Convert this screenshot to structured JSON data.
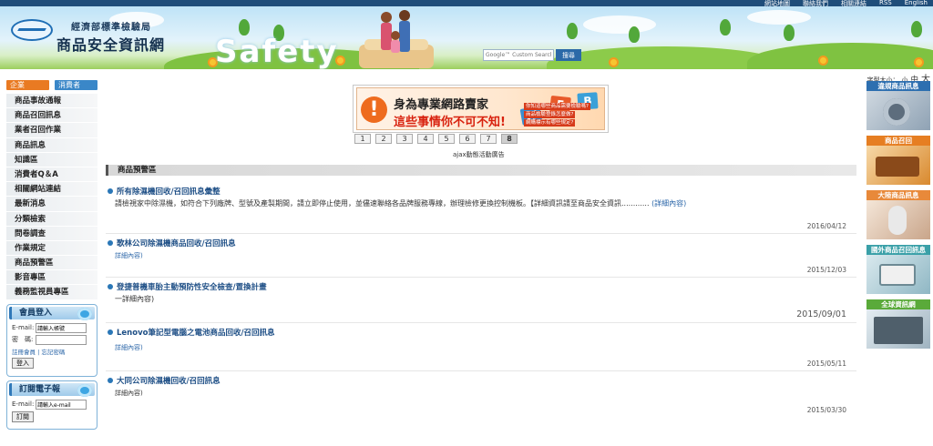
{
  "top_links": [
    "網站地圖",
    "聯絡我們",
    "相關連結",
    "RSS",
    "English"
  ],
  "banner": {
    "agency": "經濟部標準檢驗局",
    "site_name": "商品安全資訊網",
    "hero_word": "Safety",
    "search_placeholder": "Google™ Custom Search",
    "search_button": "搜尋"
  },
  "font_size": {
    "label": "字型大小：",
    "small": "小",
    "medium": "中",
    "large": "大"
  },
  "sidebar": {
    "tabs": [
      "企業",
      "消費者"
    ],
    "menu": [
      "商品事故通報",
      "商品召回訊息",
      "業者召回作業",
      "商品訊息",
      "知識區",
      "消費者Q＆A",
      "相關網站連結",
      "最新消息",
      "分類檢索",
      "問卷調查",
      "作業規定",
      "商品預警區",
      "影音專區",
      "義務監視員專區"
    ],
    "login": {
      "title": "會員登入",
      "email_label": "E-mail:",
      "email_value": "請輸入帳號",
      "password_label": "密　碼:",
      "register": "註冊會員",
      "separator": "|",
      "forgot": "忘記密碼",
      "submit": "登入"
    },
    "newsletter": {
      "title": "訂閱電子報",
      "email_label": "E-mail:",
      "email_value": "請輸入e-mail",
      "submit": "訂閱"
    }
  },
  "ad": {
    "warning": "!",
    "line1": "身為專業網路賣家",
    "line2": "這些事情你不可不知!",
    "tiles": [
      "W",
      "E",
      "B"
    ],
    "notes": [
      "你知道哪些商品需要檢驗嗎?",
      "商品檢驗登錄怎麼做?",
      "網購標示有哪些規定?"
    ],
    "pages": [
      "1",
      "2",
      "3",
      "4",
      "5",
      "6",
      "7",
      "8"
    ],
    "active_page": "8",
    "caption": "ajax動態活動廣告"
  },
  "section_title": "商品預警區",
  "news": [
    {
      "title": "所有除濕機回收/召回訊息彙整",
      "body": "請檢視家中除濕機，如符合下列廠牌、型號及產製期間，請立即停止使用，並儘速聯絡各品牌服務專線，辦理檢修更換控制機板。【詳細資訊請至商品安全資訊............",
      "more": "(詳細內容)",
      "date": "2016/04/12"
    },
    {
      "title": "歌林公司除濕機商品回收/召回訊息",
      "body": "",
      "more": "詳細內容)",
      "date": "2015/12/03"
    },
    {
      "title": "登捷普機車胎主動預防性安全檢查/置換計畫",
      "body": "",
      "more": "一詳細內容)",
      "date": "2015/09/01"
    },
    {
      "title": "Lenovo筆記型電腦之電池商品回收/召回訊息",
      "body": "",
      "more": "詳細內容)",
      "date": "2015/05/11"
    },
    {
      "title": "大同公司除濕機回收/召回訊息",
      "body": "",
      "more": "詳細內容)",
      "date": "2015/03/30"
    }
  ],
  "right_blocks": [
    {
      "title": "違規商品訊息",
      "color": "#2d6fb0"
    },
    {
      "title": "商品召回",
      "color": "#e67e22"
    },
    {
      "title": "大陸商品訊息",
      "color": "#e8893a"
    },
    {
      "title": "國外商品召回訊息",
      "color": "#3aa0a8"
    },
    {
      "title": "全球資訊網",
      "color": "#5aaa3a"
    }
  ]
}
